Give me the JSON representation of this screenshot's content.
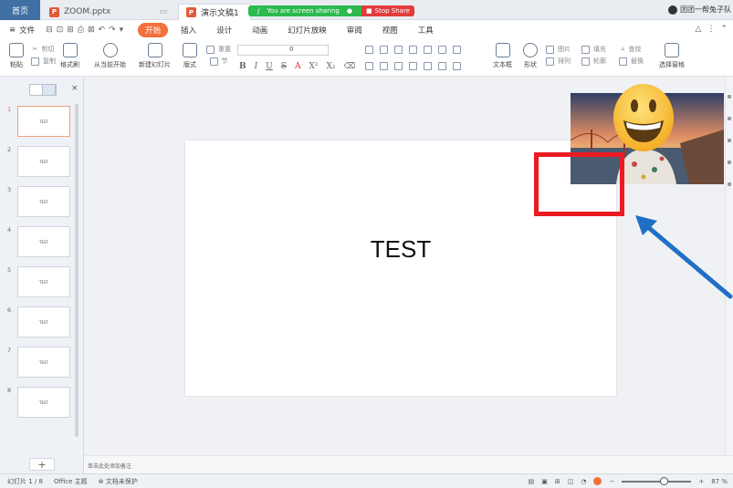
{
  "tabs": {
    "home": "首页",
    "zoom": "ZOOM.pptx",
    "doc": "演示文稿1"
  },
  "share": {
    "status": "You are screen sharing",
    "stop": "Stop Share"
  },
  "user": {
    "name": "团团一帮兔子队"
  },
  "menu": {
    "file": "文件",
    "tabs": [
      "开始",
      "插入",
      "设计",
      "动画",
      "幻灯片放映",
      "审阅",
      "视图",
      "工具"
    ]
  },
  "ribbon": {
    "paste": "粘贴",
    "cut": "剪切",
    "copy": "复制",
    "format_painter": "格式刷",
    "from_current": "从当前开始",
    "new_slide": "新建幻灯片",
    "layout": "版式",
    "reset": "重置",
    "section": "节",
    "font_size": "0",
    "textbox": "文本框",
    "shape": "形状",
    "arrange": "排列",
    "picture": "图片",
    "fill": "填充",
    "outline": "轮廓",
    "find": "查找",
    "replace": "替换",
    "select_pane": "选择窗格"
  },
  "slides": {
    "numbers": [
      "1",
      "2",
      "3",
      "4",
      "5",
      "6",
      "7",
      "8"
    ],
    "thumb_label": "TEST",
    "active_index": 1
  },
  "slide": {
    "title": "TEST"
  },
  "notes": {
    "placeholder": "单击此处添加备注"
  },
  "status": {
    "slide_info": "幻灯片 1 / 8",
    "theme": "Office 主题",
    "protect": "文档未保护",
    "zoom": "87 %",
    "zoom_fraction": 0.6
  },
  "colors": {
    "accent": "#f3713c",
    "share_green": "#2cba4d",
    "stop_red": "#e23c3c",
    "highlight_red": "#ec1a22",
    "arrow_blue": "#1f6fc5"
  },
  "icons": {
    "close": "close-icon",
    "add": "plus-icon",
    "webcam": "webcam-video",
    "emoji": "grinning-face-emoji"
  }
}
